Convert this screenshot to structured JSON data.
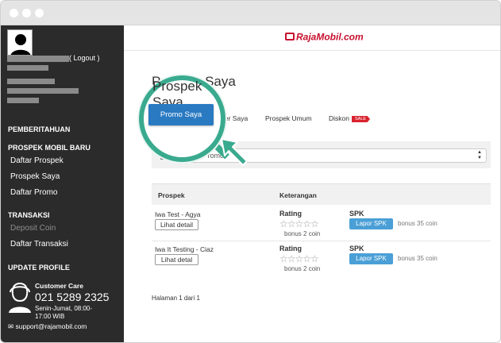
{
  "sidebar": {
    "logout": "( Logout )",
    "sections": [
      {
        "label": "PEMBERITAHUAN",
        "items": []
      },
      {
        "label": "PROSPEK MOBIL BARU",
        "items": [
          "Daftar Prospek",
          "Prospek Saya",
          "Daftar Promo"
        ]
      },
      {
        "label": "TRANSAKSI",
        "items": [
          "Deposit Coin",
          "Daftar Transaksi"
        ]
      },
      {
        "label": "UPDATE PROFILE",
        "items": []
      }
    ],
    "customer_care": {
      "title": "Customer Care",
      "phone": "021 5289 2325",
      "hours": "Senin-Jumat, 08:00-17:00 WIB",
      "email": "support@rajamobil.com"
    }
  },
  "header": {
    "logo": "RajaMobil.com"
  },
  "page": {
    "title": "Prospek Saya"
  },
  "tabs": {
    "promo": "Promo Saya",
    "dealer": "ler Saya",
    "umum": "Prospek Umum",
    "diskon": "Diskon",
    "sale_badge": "SALE"
  },
  "filter": {
    "select_value": "mita Promo"
  },
  "table": {
    "headers": [
      "Prospek",
      "Keterangan"
    ],
    "rows": [
      {
        "name": "Iwa Test - Agya",
        "detail": "Lihat detail",
        "rating_label": "Rating",
        "stars": "☆☆☆☆☆",
        "rating_bonus": "bonus 2 coin",
        "spk_label": "SPK",
        "spk_button": "Lapor SPK",
        "spk_bonus": "bonus 35 coin"
      },
      {
        "name": "Iwa It Testing - Ciaz",
        "detail": "Lihat detal",
        "rating_label": "Rating",
        "stars": "☆☆☆☆☆",
        "rating_bonus": "bonus 2 coin",
        "spk_label": "SPK",
        "spk_button": "Lapor SPK",
        "spk_bonus": "bonus 35 coin"
      }
    ]
  },
  "pagination": "Halaman 1 dari 1",
  "colors": {
    "accent": "#3aaa8f",
    "primary_button": "#2a7ac2",
    "spk_button": "#4a9fd6",
    "sidebar": "#2b2b2b",
    "sale": "#d9232e"
  }
}
